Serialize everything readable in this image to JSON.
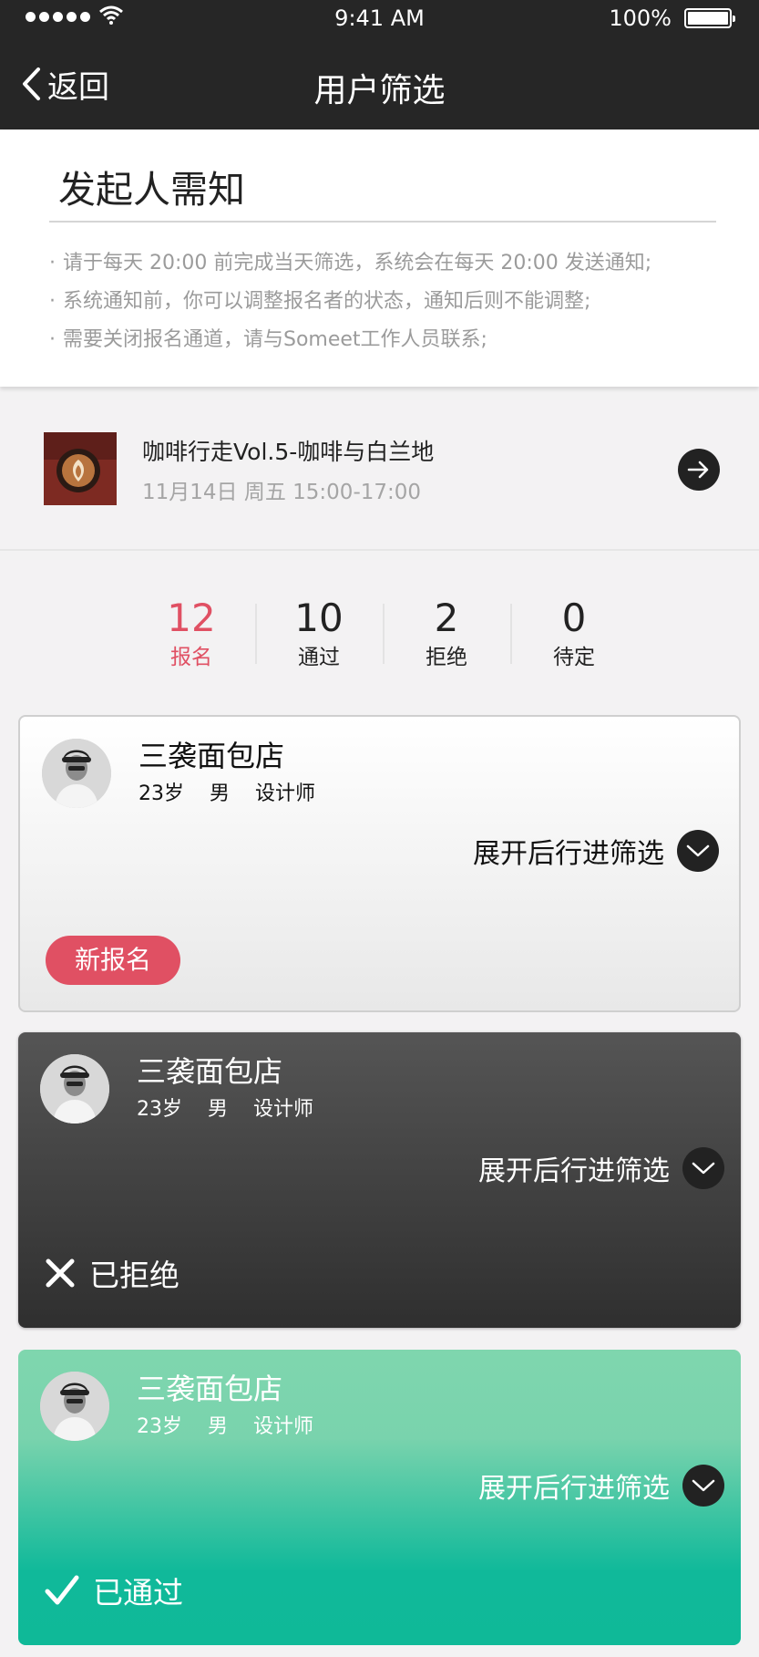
{
  "status_bar": {
    "time": "9:41 AM",
    "battery": "100%"
  },
  "nav": {
    "back_label": "返回",
    "title": "用户筛选"
  },
  "notice": {
    "title": "发起人需知",
    "items": [
      "请于每天 20:00 前完成当天筛选，系统会在每天 20:00 发送通知;",
      "系统通知前，你可以调整报名者的状态，通知后则不能调整;",
      "需要关闭报名通道，请与Someet工作人员联系;"
    ]
  },
  "event": {
    "title": "咖啡行走Vol.5-咖啡与白兰地",
    "date": "11月14日 周五 15:00-17:00"
  },
  "stats": [
    {
      "num": "12",
      "label": "报名"
    },
    {
      "num": "10",
      "label": "通过"
    },
    {
      "num": "2",
      "label": "拒绝"
    },
    {
      "num": "0",
      "label": "待定"
    }
  ],
  "colors": {
    "accent": "#e05063",
    "pass_green": "#0fb998",
    "dark": "#262626"
  },
  "applicants": [
    {
      "name": "三袭面包店",
      "age": "23岁",
      "gender": "男",
      "job": "设计师",
      "expand": "展开后行进筛选",
      "status": "新报名"
    },
    {
      "name": "三袭面包店",
      "age": "23岁",
      "gender": "男",
      "job": "设计师",
      "expand": "展开后行进筛选",
      "status": "已拒绝"
    },
    {
      "name": "三袭面包店",
      "age": "23岁",
      "gender": "男",
      "job": "设计师",
      "expand": "展开后行进筛选",
      "status": "已通过"
    }
  ]
}
